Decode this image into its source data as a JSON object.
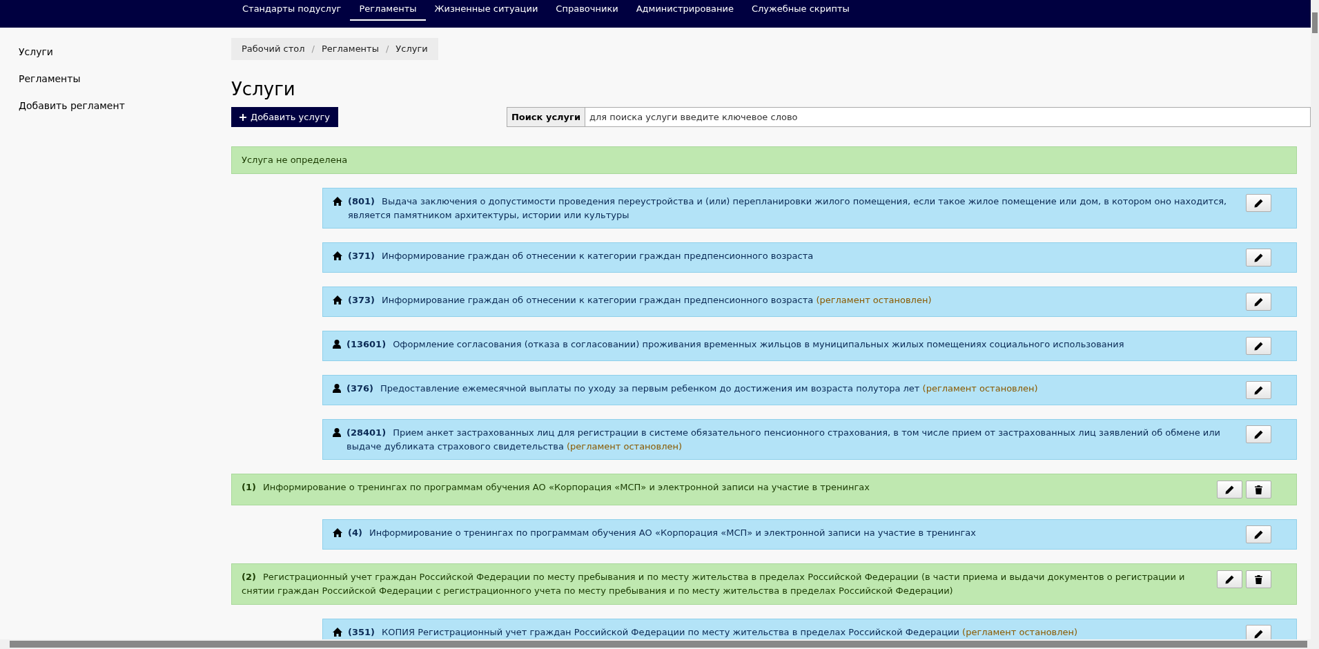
{
  "nav": {
    "items": [
      {
        "label": "Стандарты подуслуг",
        "selected": false
      },
      {
        "label": "Регламенты",
        "selected": true
      },
      {
        "label": "Жизненные ситуации",
        "selected": false
      },
      {
        "label": "Справочники",
        "selected": false
      },
      {
        "label": "Администрирование",
        "selected": false
      },
      {
        "label": "Служебные скрипты",
        "selected": false
      }
    ]
  },
  "sidebar": {
    "items": [
      "Услуги",
      "Регламенты",
      "Добавить регламент"
    ]
  },
  "breadcrumb": [
    "Рабочий стол",
    "Регламенты",
    "Услуги"
  ],
  "breadcrumb_separator": "/",
  "title": "Услуги",
  "add_button": "Добавить услугу",
  "search": {
    "label": "Поиск услуги",
    "placeholder": "для поиска услуги введите ключевое слово"
  },
  "groups": [
    {
      "title": "Услуга не определена",
      "editable": false,
      "children": [
        {
          "kind": "home",
          "number": "(801)",
          "title": "Выдача заключения о допустимости проведения переустройства и (или) перепланировки жилого помещения, если такое жилое помещение или дом, в котором оно находится, является памятником архитектуры, истории или культуры"
        },
        {
          "kind": "home",
          "number": "(371)",
          "title": "Информирование граждан об отнесении к категории граждан предпенсионного возраста"
        },
        {
          "kind": "home",
          "number": "(373)",
          "title": "Информирование граждан об отнесении к категории граждан предпенсионного возраста",
          "status": "(регламент остановлен)"
        },
        {
          "kind": "person",
          "number": "(13601)",
          "title": "Оформление согласования (отказа в согласовании) проживания временных жильцов в муниципальных жилых помещениях социального использования"
        },
        {
          "kind": "person",
          "number": "(376)",
          "title": "Предоставление ежемесячной выплаты по уходу за первым ребенком до достижения им возраста полутора лет",
          "status": "(регламент остановлен)"
        },
        {
          "kind": "person",
          "number": "(28401)",
          "title": "Прием анкет застрахованных лиц для регистрации в системе обязательного пенсионного страхования, в том числе прием от застрахованных лиц заявлений об обмене или выдаче дубликата страхового свидетельства",
          "status": "(регламент остановлен)"
        }
      ]
    },
    {
      "number": "(1)",
      "title": "Информирование о тренингах по программам обучения АО «Корпорация «МСП» и электронной записи на участие в тренингах",
      "editable": true,
      "children": [
        {
          "kind": "home",
          "number": "(4)",
          "title": "Информирование о тренингах по программам обучения АО «Корпорация «МСП» и электронной записи на участие в тренингах"
        }
      ]
    },
    {
      "number": "(2)",
      "title": "Регистрационный учет граждан Российской Федерации по месту пребывания и по месту жительства в пределах Российской Федерации (в части приема и выдачи документов о регистрации и снятии граждан Российской Федерации с регистрационного учета по месту пребывания и по месту жительства в пределах Российской Федерации)",
      "editable": true,
      "children": [
        {
          "kind": "home",
          "number": "(351)",
          "title": "КОПИЯ Регистрационный учет граждан Российской Федерации по месту жительства в пределах Российской Федерации",
          "status": "(регламент остановлен)"
        }
      ]
    }
  ]
}
